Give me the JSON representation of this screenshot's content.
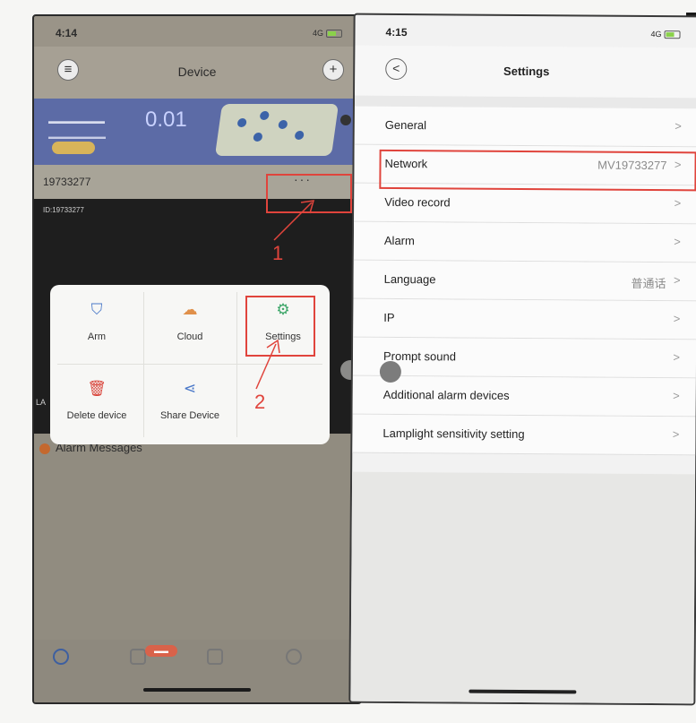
{
  "left": {
    "status": {
      "time": "4:14",
      "signal": "4G"
    },
    "header": {
      "title": "Device",
      "menu_icon": "list-icon",
      "add_icon": "+"
    },
    "banner": {
      "amount": "0.01"
    },
    "device": {
      "name": "19733277",
      "id": "ID:19733277",
      "more": "···",
      "corner": "LA"
    },
    "menu": {
      "arm": "Arm",
      "cloud": "Cloud",
      "settings": "Settings",
      "delete": "Delete device",
      "share": "Share Device"
    },
    "alarm_messages": "Alarm Messages",
    "annotations": {
      "step1": "1",
      "step2": "2",
      "color": "#e0443c"
    }
  },
  "right": {
    "status": {
      "time": "4:15",
      "signal": "4G"
    },
    "nav": {
      "title": "Settings",
      "back": "<"
    },
    "rows": [
      {
        "label": "General",
        "value": ""
      },
      {
        "label": "Network",
        "value": "MV19733277"
      },
      {
        "label": "Video record",
        "value": ""
      },
      {
        "label": "Alarm",
        "value": ""
      },
      {
        "label": "Language",
        "value": "普通话"
      },
      {
        "label": "IP",
        "value": ""
      },
      {
        "label": "Prompt sound",
        "value": ""
      },
      {
        "label": "Additional alarm devices",
        "value": ""
      },
      {
        "label": "Lamplight sensitivity setting",
        "value": ""
      }
    ],
    "chevron": ">"
  }
}
